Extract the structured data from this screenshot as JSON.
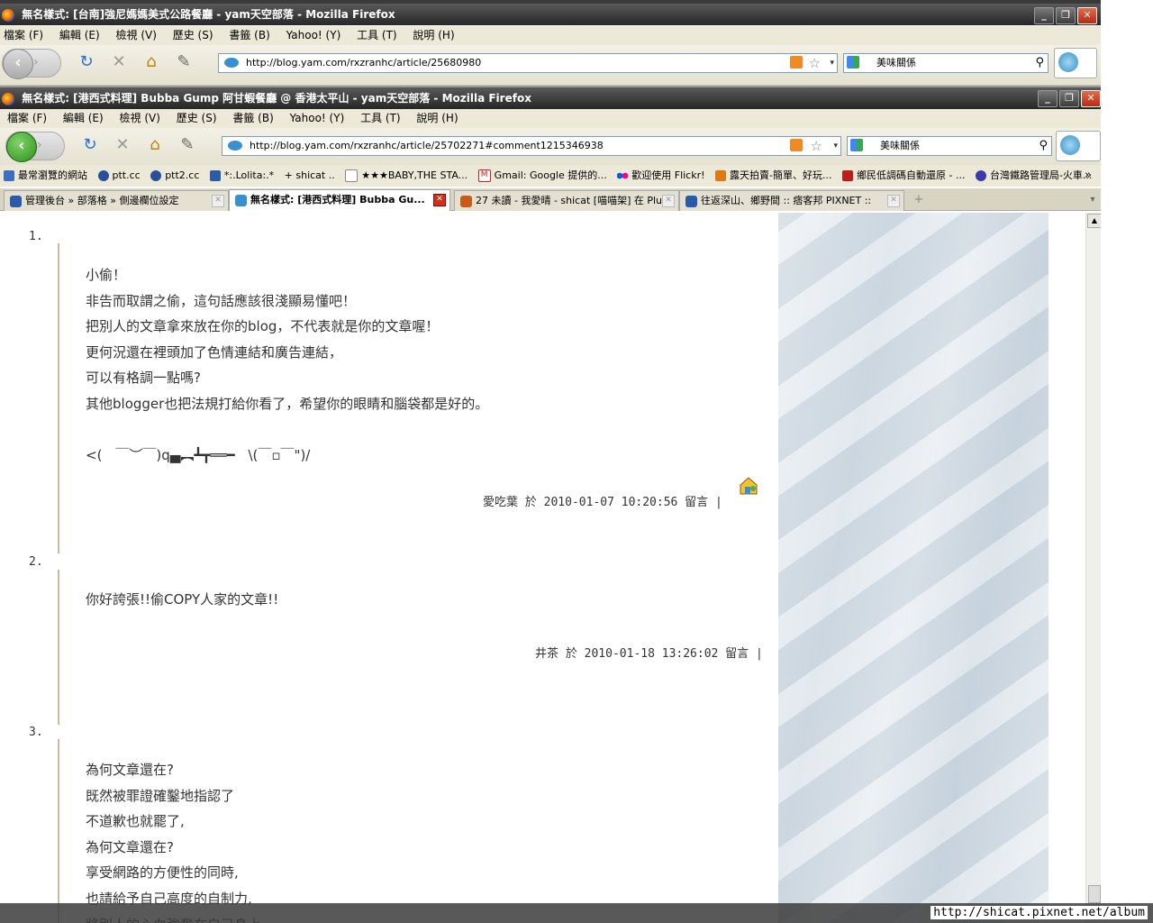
{
  "window1": {
    "title": "無名樣式: [台南]強尼媽媽美式公路餐廳 - yam天空部落 - Mozilla Firefox",
    "menu": [
      "檔案 (F)",
      "編輯 (E)",
      "檢視 (V)",
      "歷史 (S)",
      "書籤 (B)",
      "Yahoo! (Y)",
      "工具 (T)",
      "說明 (H)"
    ],
    "url": "http://blog.yam.com/rxzranhc/article/25680980",
    "search": "美味關係"
  },
  "window2": {
    "title": "無名樣式: [港西式料理] Bubba Gump 阿甘蝦餐廳 @ 香港太平山 - yam天空部落 - Mozilla Firefox",
    "menu": [
      "檔案 (F)",
      "編輯 (E)",
      "檢視 (V)",
      "歷史 (S)",
      "書籤 (B)",
      "Yahoo! (Y)",
      "工具 (T)",
      "說明 (H)"
    ],
    "url": "http://blog.yam.com/rxzranhc/article/25702271#comment1215346938",
    "search": "美味關係",
    "bookmarks": [
      {
        "label": "最常瀏覽的網站",
        "color": "#3a6fc4"
      },
      {
        "label": "ptt.cc",
        "color": "#2a4f9a"
      },
      {
        "label": "ptt2.cc",
        "color": "#2a4f9a"
      },
      {
        "label": "*:.Lolita:.*",
        "color": "#2a5aa8"
      },
      {
        "label": "+ shicat ..",
        "color": "#ece9d8"
      },
      {
        "label": "★★★BABY,THE STA...",
        "color": "#ffffff"
      },
      {
        "label": "Gmail: Google 提供的...",
        "color": "#c8201a"
      },
      {
        "label": "歡迎使用 Flickr!",
        "color": "#e0208a"
      },
      {
        "label": "露天拍賣-簡單、好玩...",
        "color": "#e07a10"
      },
      {
        "label": "鄉民低調碼自動還原 - ...",
        "color": "#c01a1a"
      },
      {
        "label": "台灣鐵路管理局-火車...",
        "color": "#3a3aa8"
      }
    ],
    "more_bookmarks": "»",
    "tabs": [
      {
        "label": "管理後台 » 部落格 » 側邊欄位設定"
      },
      {
        "label": "無名樣式: [港西式料理] Bubba Gu..."
      },
      {
        "label": "27 未讀 - 我愛晴 - shicat [喵喵架] 在 Plu..."
      },
      {
        "label": "往返深山、鄉野間 :: 痞客邦 PIXNET ::"
      }
    ],
    "new_tab": "+",
    "tab_list": "▾"
  },
  "comments": [
    {
      "number": "1.",
      "text": "小偷！\n非告而取謂之偷，這句話應該很淺顯易懂吧！\n把別人的文章拿來放在你的blog，不代表就是你的文章喔！\n更何況還在裡頭加了色情連結和廣告連結，\n可以有格調一點嗎?\n其他blogger也把法規打給你看了，希望你的眼睛和腦袋都是好的。\n\n<(　￣︶￣)q▄︻┻┳══━　\\(￣▫￣\")/",
      "meta": "愛吃葉 於 2010-01-07 10:20:56 留言 |"
    },
    {
      "number": "2.",
      "text": "你好誇張!!偷COPY人家的文章!!",
      "meta": "井茶 於 2010-01-18 13:26:02 留言 |"
    },
    {
      "number": "3.",
      "text": "為何文章還在?\n既然被罪證確鑿地指認了\n不道歉也就罷了,\n為何文章還在?\n享受網路的方便性的同時,\n也請給予自己高度的自制力,\n將別人的心血強奪在自己身上",
      "meta": ""
    }
  ],
  "status": {
    "text": "http://shicat.pixnet.net/album"
  }
}
